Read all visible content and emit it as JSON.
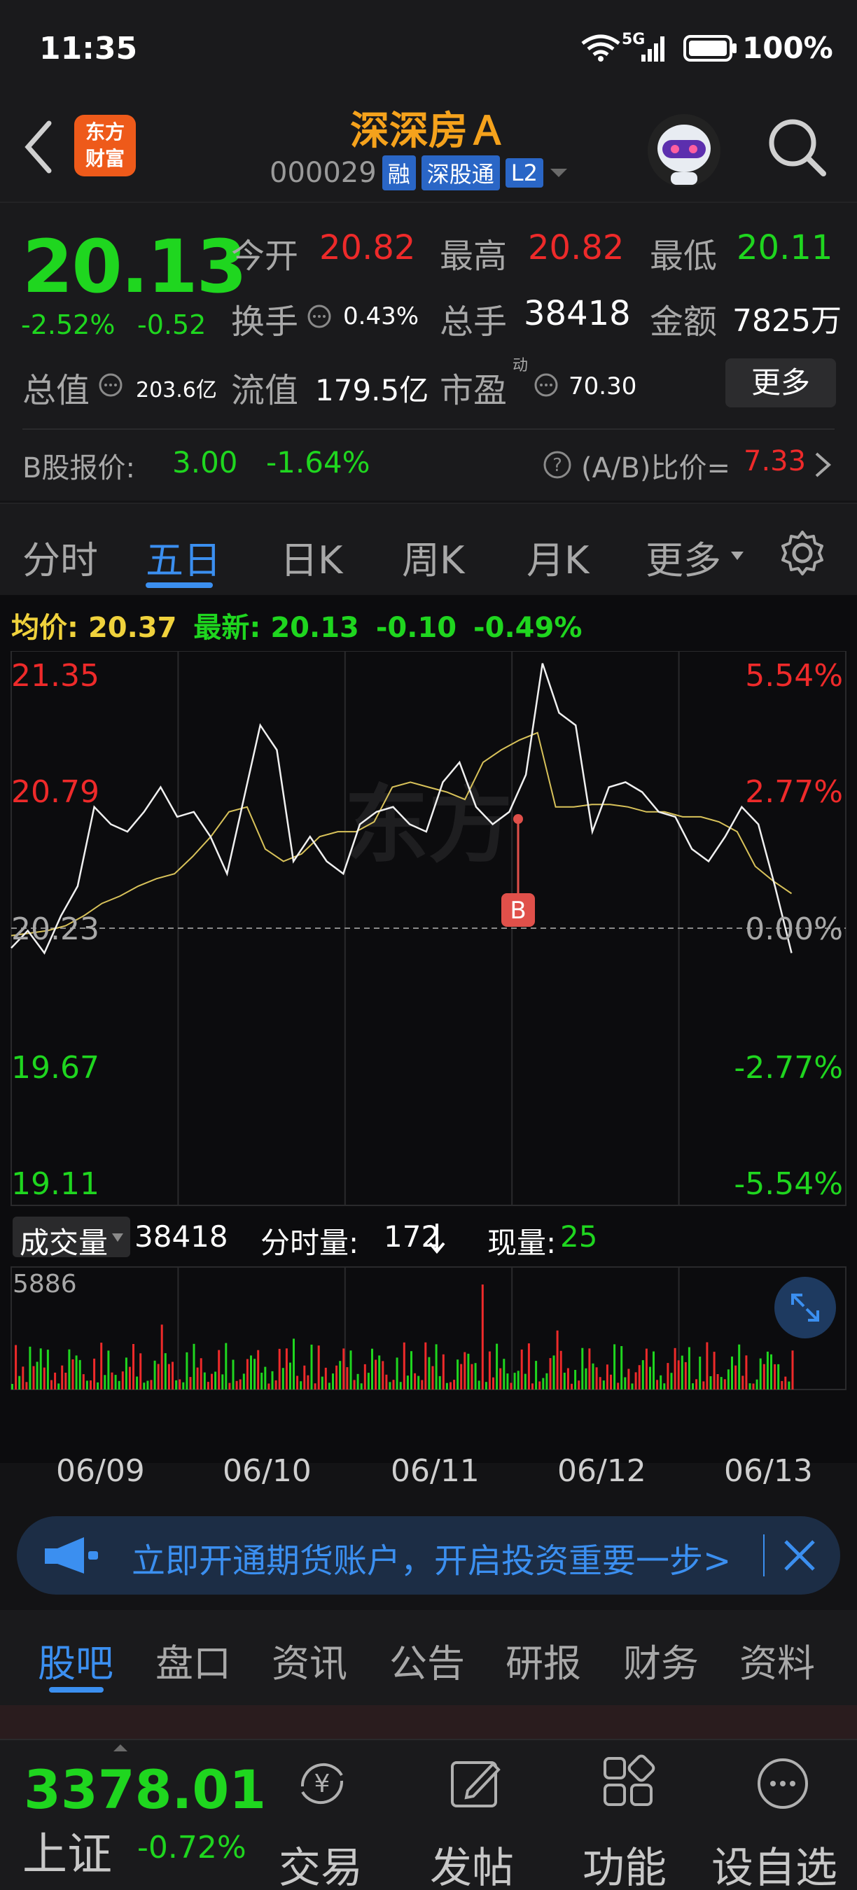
{
  "status_bar": {
    "time": "11:35",
    "network": "5G",
    "battery": "100%"
  },
  "header": {
    "name": "深深房Ａ",
    "code": "000029",
    "tags": [
      "融",
      "深股通",
      "L2"
    ],
    "logo_text_1": "东方",
    "logo_text_2": "财富"
  },
  "quote": {
    "price": "20.13",
    "change_pct": "-2.52%",
    "change": "-0.52",
    "open_label": "今开",
    "open": "20.82",
    "high_label": "最高",
    "high": "20.82",
    "low_label": "最低",
    "low": "20.11",
    "turnover_label": "换手",
    "turnover": "0.43%",
    "volume_label": "总手",
    "volume": "38418",
    "amount_label": "金额",
    "amount": "7825万",
    "mktcap_label": "总值",
    "mktcap": "203.6亿",
    "float_label": "流值",
    "float": "179.5亿",
    "pe_label": "市盈",
    "pe_sup": "动",
    "pe": "70.30",
    "more_label": "更多"
  },
  "bshare": {
    "label": "B股报价:",
    "price": "3.00",
    "pct": "-1.64%",
    "ratio_label": "(A/B)比价=",
    "ratio": "7.33"
  },
  "tabs": [
    "分时",
    "五日",
    "日K",
    "周K",
    "月K",
    "更多"
  ],
  "active_tab": "五日",
  "chart_legend": {
    "avg_label": "均价:",
    "avg": "20.37",
    "last_label": "最新:",
    "last": "20.13",
    "chg": "-0.10",
    "chg_pct": "-0.49%"
  },
  "chart_data": {
    "type": "line",
    "y_left": [
      "21.35",
      "20.79",
      "20.23",
      "19.67",
      "19.11"
    ],
    "y_right": [
      "5.54%",
      "2.77%",
      "0.00%",
      "-2.77%",
      "-5.54%"
    ],
    "x_labels": [
      "06/09",
      "06/10",
      "06/11",
      "06/12",
      "06/13"
    ],
    "ylim": [
      19.11,
      21.35
    ],
    "prev_close": 20.23,
    "series": [
      {
        "name": "最新",
        "values": [
          20.15,
          20.22,
          20.13,
          20.28,
          20.4,
          20.72,
          20.65,
          20.62,
          20.7,
          20.8,
          20.68,
          20.7,
          20.6,
          20.45,
          20.75,
          21.05,
          20.95,
          20.5,
          20.6,
          20.5,
          20.45,
          20.65,
          20.7,
          20.72,
          20.65,
          20.62,
          20.82,
          20.9,
          20.72,
          20.65,
          20.7,
          20.85,
          21.3,
          21.1,
          21.05,
          20.62,
          20.8,
          20.82,
          20.78,
          20.7,
          20.68,
          20.55,
          20.5,
          20.6,
          20.72,
          20.65,
          20.4,
          20.13
        ]
      },
      {
        "name": "均价",
        "values": [
          20.2,
          20.21,
          20.22,
          20.24,
          20.28,
          20.33,
          20.36,
          20.4,
          20.43,
          20.45,
          20.52,
          20.6,
          20.7,
          20.72,
          20.55,
          20.5,
          20.53,
          20.6,
          20.62,
          20.62,
          20.66,
          20.8,
          20.82,
          20.8,
          20.78,
          20.75,
          20.9,
          20.95,
          20.99,
          21.02,
          20.72,
          20.72,
          20.73,
          20.73,
          20.72,
          20.7,
          20.7,
          20.68,
          20.68,
          20.66,
          20.62,
          20.48,
          20.42,
          20.37
        ]
      }
    ]
  },
  "volume_panel": {
    "label": "成交量",
    "total": "38418",
    "tick_label": "分时量:",
    "tick": "172",
    "now_label": "现量:",
    "now": "25",
    "max": "5886"
  },
  "banner": {
    "text": "立即开通期货账户，开启投资重要一步>"
  },
  "bottom_tabs": [
    "股吧",
    "盘口",
    "资讯",
    "公告",
    "研报",
    "财务",
    "资料"
  ],
  "index_ticker": {
    "value": "3378.01",
    "name": "上证",
    "pct": "-0.72%"
  },
  "nav": [
    "交易",
    "发帖",
    "功能",
    "设自选"
  ],
  "colors": {
    "up": "#ee2a2a",
    "down": "#1fd61f",
    "accent": "#3b8ff0",
    "brand": "#f5a21c"
  }
}
